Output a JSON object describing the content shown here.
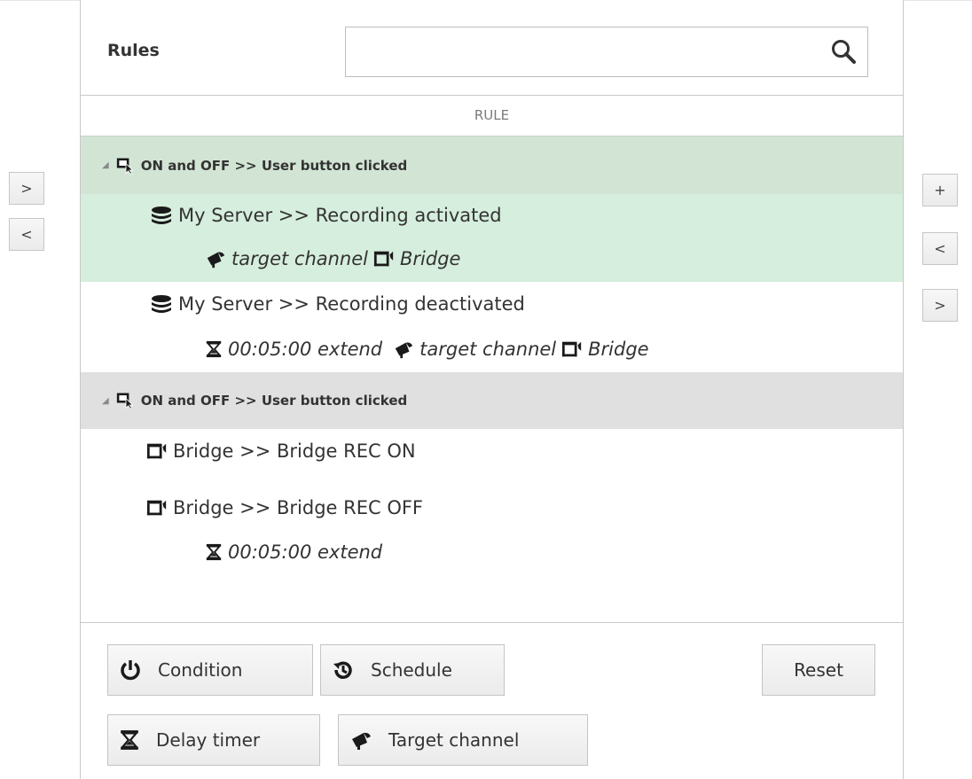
{
  "panel": {
    "title": "Rules",
    "search": {
      "value": "",
      "placeholder": "",
      "icon": "search-icon"
    }
  },
  "column_header": "RULE",
  "left_side_buttons": [
    ">",
    "<"
  ],
  "right_side_buttons": [
    "+",
    "<",
    ">"
  ],
  "rules": [
    {
      "header": "ON and OFF >> User button clicked",
      "header_bg": "#d2e5d4",
      "icon": "user-button-icon",
      "selected": true,
      "actions": [
        {
          "label": "My Server >> Recording activated",
          "icon": "server-stack-icon",
          "selected": true,
          "params": [
            {
              "label": "target channel",
              "icon": "target-channel-icon"
            },
            {
              "label": "Bridge",
              "icon": "bridge-icon"
            }
          ]
        },
        {
          "label": "My Server >> Recording deactivated",
          "icon": "server-stack-icon",
          "selected": false,
          "params": [
            {
              "label": "00:05:00 extend",
              "icon": "hourglass-icon"
            },
            {
              "label": "target channel",
              "icon": "target-channel-icon"
            },
            {
              "label": "Bridge",
              "icon": "bridge-icon"
            }
          ]
        }
      ]
    },
    {
      "header": "ON and OFF >> User button clicked",
      "header_bg": "#e0e0e0",
      "icon": "user-button-icon",
      "selected": false,
      "actions": [
        {
          "label": "Bridge >> Bridge REC ON",
          "icon": "bridge-icon",
          "params": []
        },
        {
          "label": "Bridge >> Bridge REC OFF",
          "icon": "bridge-icon",
          "params": [
            {
              "label": "00:05:00 extend",
              "icon": "hourglass-icon"
            }
          ]
        }
      ]
    }
  ],
  "bottom_buttons": {
    "condition": "Condition",
    "schedule": "Schedule",
    "reset": "Reset",
    "delay_timer": "Delay timer",
    "target_channel": "Target channel"
  },
  "colors": {
    "selection_row": "#d6eedd",
    "selection_header": "#d2e5d4",
    "group_header": "#e0e0e0",
    "border": "#c8c8c8"
  }
}
